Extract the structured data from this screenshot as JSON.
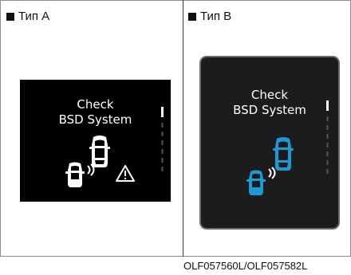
{
  "panels": [
    {
      "label": "Тип A",
      "message": [
        "Check",
        "BSD System"
      ],
      "icon_color": "#ffffff",
      "warning": true
    },
    {
      "label": "Тип B",
      "message": [
        "Check",
        "BSD System"
      ],
      "icon_color": "#1a9ad6",
      "warning": false
    }
  ],
  "icons": [
    "car-icon",
    "radar-waves-icon",
    "warning-triangle-icon",
    "scroll-indicator-icon"
  ],
  "footer_code": "OLF057560L/OLF057582L"
}
